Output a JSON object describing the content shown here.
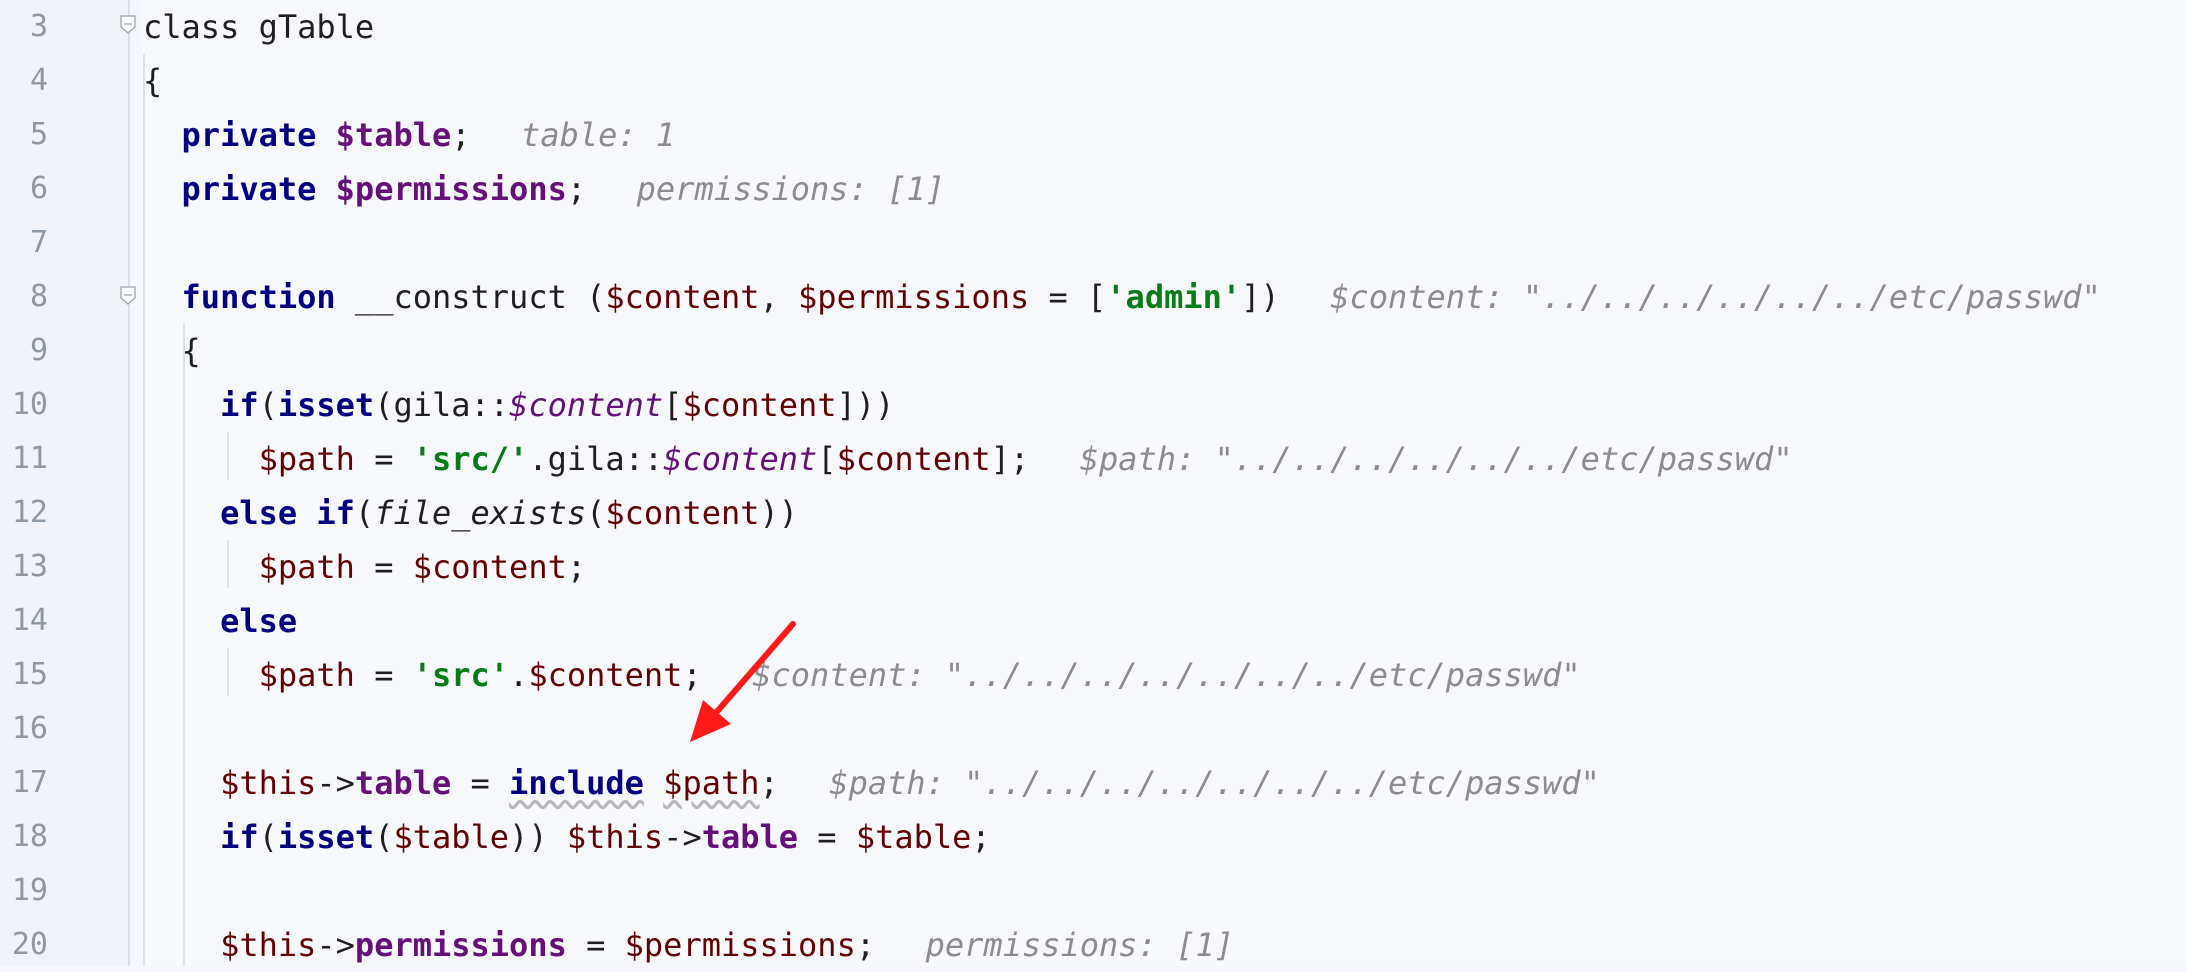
{
  "editor": {
    "lines": [
      {
        "num": "3",
        "segs": [
          [
            "kw2",
            "class"
          ],
          [
            "p",
            " gTable"
          ]
        ]
      },
      {
        "num": "4",
        "segs": [
          [
            "p",
            "{"
          ]
        ]
      },
      {
        "num": "5",
        "segs": [
          [
            "p",
            "  "
          ],
          [
            "kw",
            "private"
          ],
          [
            "p",
            " "
          ],
          [
            "fld",
            "$table"
          ],
          [
            "p",
            ";  "
          ],
          [
            "hint",
            "table: 1"
          ]
        ]
      },
      {
        "num": "6",
        "segs": [
          [
            "p",
            "  "
          ],
          [
            "kw",
            "private"
          ],
          [
            "p",
            " "
          ],
          [
            "fld",
            "$permissions"
          ],
          [
            "p",
            ";  "
          ],
          [
            "hint",
            "permissions: [1]"
          ]
        ]
      },
      {
        "num": "7",
        "segs": []
      },
      {
        "num": "8",
        "segs": [
          [
            "p",
            "  "
          ],
          [
            "kw",
            "function"
          ],
          [
            "p",
            " __construct ("
          ],
          [
            "var",
            "$content"
          ],
          [
            "p",
            ", "
          ],
          [
            "var",
            "$permissions"
          ],
          [
            "p",
            " = ["
          ],
          [
            "str",
            "'admin'"
          ],
          [
            "p",
            "])  "
          ],
          [
            "hint",
            "$content: \"../../../../../../etc/passwd\""
          ]
        ]
      },
      {
        "num": "9",
        "segs": [
          [
            "p",
            "  {"
          ]
        ]
      },
      {
        "num": "10",
        "segs": [
          [
            "p",
            "    "
          ],
          [
            "kw",
            "if"
          ],
          [
            "p",
            "("
          ],
          [
            "kw",
            "isset"
          ],
          [
            "p",
            "(gila::"
          ],
          [
            "sfld",
            "$content"
          ],
          [
            "p",
            "["
          ],
          [
            "var",
            "$content"
          ],
          [
            "p",
            "]))"
          ]
        ]
      },
      {
        "num": "11",
        "segs": [
          [
            "p",
            "      "
          ],
          [
            "var",
            "$path"
          ],
          [
            "p",
            " = "
          ],
          [
            "str",
            "'src/'"
          ],
          [
            "p",
            ".gila::"
          ],
          [
            "sfld",
            "$content"
          ],
          [
            "p",
            "["
          ],
          [
            "var",
            "$content"
          ],
          [
            "p",
            "];  "
          ],
          [
            "hint",
            "$path: \"../../../../../../etc/passwd\""
          ]
        ]
      },
      {
        "num": "12",
        "segs": [
          [
            "p",
            "    "
          ],
          [
            "kw",
            "else if"
          ],
          [
            "p",
            "("
          ],
          [
            "ital",
            "file_exists"
          ],
          [
            "p",
            "("
          ],
          [
            "var",
            "$content"
          ],
          [
            "p",
            "))"
          ]
        ]
      },
      {
        "num": "13",
        "segs": [
          [
            "p",
            "      "
          ],
          [
            "var",
            "$path"
          ],
          [
            "p",
            " = "
          ],
          [
            "var",
            "$content"
          ],
          [
            "p",
            ";"
          ]
        ]
      },
      {
        "num": "14",
        "segs": [
          [
            "p",
            "    "
          ],
          [
            "kw",
            "else"
          ]
        ]
      },
      {
        "num": "15",
        "segs": [
          [
            "p",
            "      "
          ],
          [
            "var",
            "$path"
          ],
          [
            "p",
            " = "
          ],
          [
            "str",
            "'src'"
          ],
          [
            "p",
            "."
          ],
          [
            "var",
            "$content"
          ],
          [
            "p",
            ";  "
          ],
          [
            "hint",
            "$content: \"../../../../../../../etc/passwd\""
          ]
        ]
      },
      {
        "num": "16",
        "segs": []
      },
      {
        "num": "17",
        "segs": [
          [
            "p",
            "    "
          ],
          [
            "var",
            "$this"
          ],
          [
            "p",
            "->"
          ],
          [
            "fld",
            "table"
          ],
          [
            "p",
            " = "
          ],
          [
            "kwu",
            "include"
          ],
          [
            "p",
            " "
          ],
          [
            "varu",
            "$path"
          ],
          [
            "p",
            ";  "
          ],
          [
            "hint",
            "$path: \"../../../../../../../etc/passwd\""
          ]
        ]
      },
      {
        "num": "18",
        "segs": [
          [
            "p",
            "    "
          ],
          [
            "kw",
            "if"
          ],
          [
            "p",
            "("
          ],
          [
            "kw",
            "isset"
          ],
          [
            "p",
            "("
          ],
          [
            "var",
            "$table"
          ],
          [
            "p",
            ")) "
          ],
          [
            "var",
            "$this"
          ],
          [
            "p",
            "->"
          ],
          [
            "fld",
            "table"
          ],
          [
            "p",
            " = "
          ],
          [
            "var",
            "$table"
          ],
          [
            "p",
            ";"
          ]
        ]
      },
      {
        "num": "19",
        "segs": []
      },
      {
        "num": "20",
        "segs": [
          [
            "p",
            "    "
          ],
          [
            "var",
            "$this"
          ],
          [
            "p",
            "->"
          ],
          [
            "fld",
            "permissions"
          ],
          [
            "p",
            " = "
          ],
          [
            "var",
            "$permissions"
          ],
          [
            "p",
            ";  "
          ],
          [
            "hint",
            "permissions: [1]"
          ]
        ]
      }
    ],
    "annotation": {
      "color": "#ff1a1a"
    },
    "colors": {
      "keyword": "#000080",
      "variable": "#660000",
      "field": "#660e7a",
      "string": "#067d17",
      "hint": "#8c8c8c",
      "gutter_bg": "#f1f3f8",
      "editor_bg": "#f5f7fc"
    }
  }
}
